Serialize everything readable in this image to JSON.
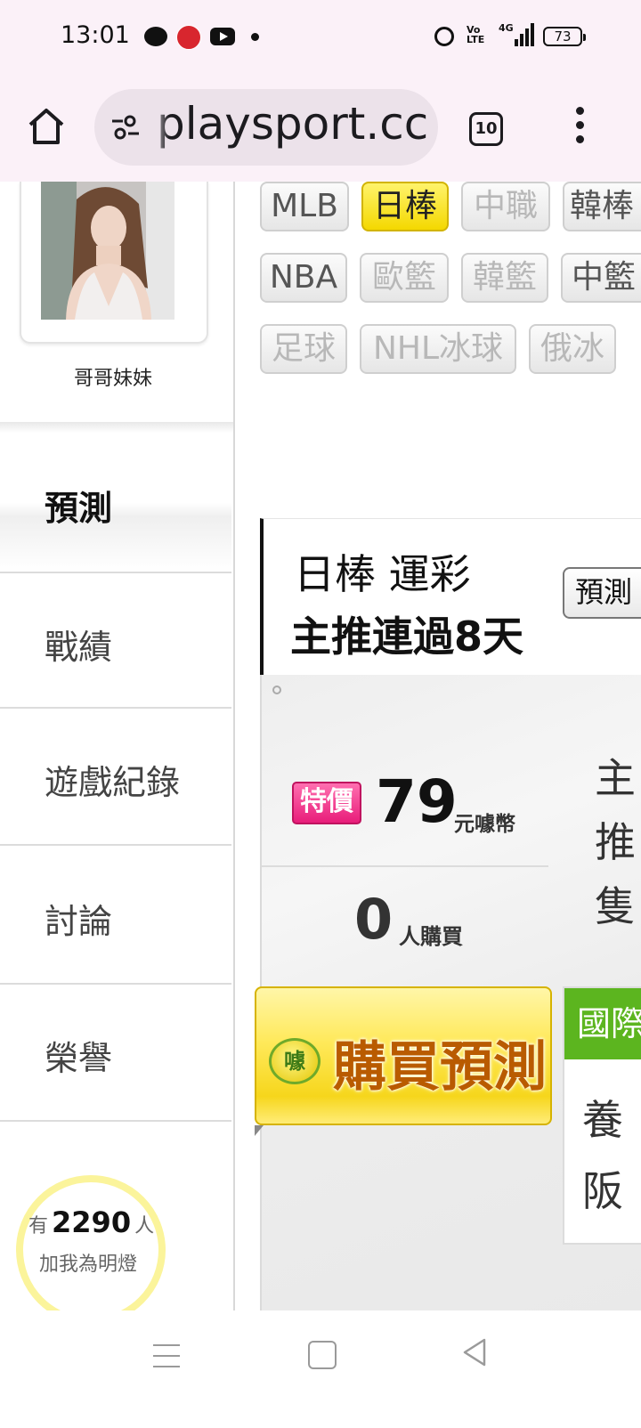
{
  "status_bar": {
    "time": "13:01",
    "icons": [
      "chat-bubble-icon",
      "app-notification-icon",
      "youtube-icon",
      "dot-icon",
      "alarm-icon",
      "volte-icon",
      "signal-4g-icon",
      "battery-icon"
    ],
    "volte_label": "Vo LTE",
    "network": "4G",
    "battery": "73"
  },
  "browser": {
    "url": "playsport.cc",
    "tab_count": "10"
  },
  "sidebar": {
    "user_name": "哥哥妹妹",
    "items": [
      {
        "label": "預測",
        "active": true
      },
      {
        "label": "戰績",
        "active": false
      },
      {
        "label": "遊戲紀錄",
        "active": false
      },
      {
        "label": "討論",
        "active": false
      },
      {
        "label": "榮譽",
        "active": false
      }
    ],
    "follow": {
      "prefix": "有",
      "count": "2290",
      "suffix": "人",
      "caption": "加我為明燈"
    }
  },
  "leagues": [
    {
      "label": "MLB",
      "state": "enabled"
    },
    {
      "label": "日棒",
      "state": "selected"
    },
    {
      "label": "中職",
      "state": "disabled"
    },
    {
      "label": "韓棒",
      "state": "enabled"
    },
    {
      "label": "NBA",
      "state": "enabled"
    },
    {
      "label": "歐籃",
      "state": "disabled"
    },
    {
      "label": "韓籃",
      "state": "disabled"
    },
    {
      "label": "中籃",
      "state": "enabled"
    },
    {
      "label": "足球",
      "state": "disabled"
    },
    {
      "label": "NHL冰球",
      "state": "disabled"
    },
    {
      "label": "俄冰",
      "state": "disabled"
    }
  ],
  "prediction": {
    "title": "日棒 運彩",
    "streak": "主推連過8天",
    "button_label": "預測"
  },
  "pricing": {
    "badge": "特價",
    "price": "79",
    "currency": "元噱幣",
    "buyers": "0",
    "buyers_unit": "人購買",
    "side_text": "主推隻"
  },
  "buy_button": {
    "coin_label": "噱",
    "label": "購買預測"
  },
  "side_card": {
    "header": "國際",
    "body": "養阪"
  },
  "colors": {
    "status_bg": "#fbf1f8",
    "selected_league": "#f4d800",
    "badge_pink": "#e81d7a",
    "card_green": "#5cb51f",
    "follow_ring": "#fbf49b"
  }
}
